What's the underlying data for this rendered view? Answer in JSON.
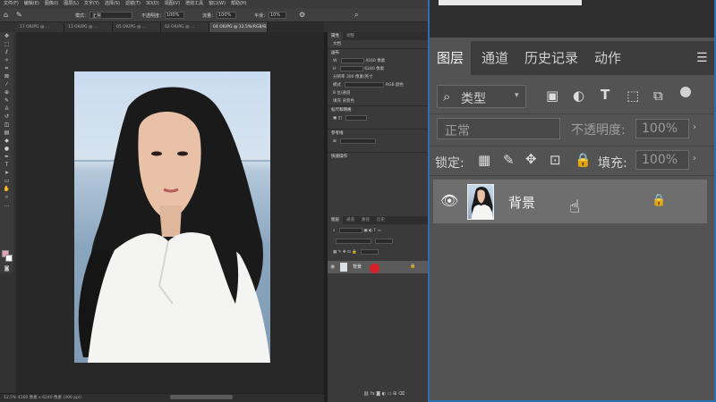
{
  "menu": [
    "文件(F)",
    "编辑(E)",
    "图像(I)",
    "图层(L)",
    "文字(Y)",
    "选择(S)",
    "滤镜(T)",
    "3D(D)",
    "视图(V)",
    "增效工具",
    "窗口(W)",
    "帮助(H)"
  ],
  "options_bar": {
    "mode_label": "模式：",
    "mode_value": "正常",
    "opacity_label": "不透明度：",
    "opacity_value": "100%",
    "flow_label": "流量：",
    "flow_value": "100%",
    "smooth_label": "平滑：",
    "smooth_value": "10%"
  },
  "doc_tabs": [
    "17 OIUPG @ ...",
    "13 OIUPG @ ...",
    "05 OIUPG @ ...",
    "02 OIUPG @ ...",
    "03 OIUPG @ ...",
    "04 OIUPG @ 12.5%(RGB/8)"
  ],
  "status_bar": "12.5%   4160 像素 x 6240 像素 (300 ppi)",
  "properties_panel": {
    "tabs": [
      "属性",
      "调整"
    ],
    "doc_label": "文档",
    "canvas_label": "画布",
    "width": "4160 像素",
    "height": "6240 像素",
    "resolution_label": "分辨率",
    "resolution_value": "300 像素/英寸",
    "mode_label": "模式",
    "mode_value": "RGB 颜色",
    "depth_value": "8 位/通道",
    "fill_label": "填充",
    "fill_value": "背景色",
    "rulers_label": "标尺和网格",
    "guides_label": "参考线",
    "quick_label": "快速操作"
  },
  "mini_layers_panel": {
    "tabs": [
      "图层",
      "通道",
      "路径",
      "历史"
    ],
    "layer_name": "背景"
  },
  "zoom_panel": {
    "tabs": [
      "图层",
      "通道",
      "历史记录",
      "动作"
    ],
    "filter_label": "类型",
    "blend_mode": "正常",
    "opacity_label": "不透明度:",
    "opacity_value": "100%",
    "lock_label": "锁定:",
    "fill_label": "填充:",
    "fill_value": "100%",
    "layer_name": "背景"
  },
  "icons": [
    "search-icon",
    "image-filter-icon",
    "adjustment-filter-icon",
    "type-filter-icon",
    "shape-filter-icon",
    "smart-object-filter-icon",
    "lock-pixels-icon",
    "lock-brush-icon",
    "lock-move-icon",
    "lock-artboard-icon",
    "lock-all-icon",
    "eye-icon",
    "lock-icon",
    "hand-cursor-icon",
    "panel-menu-icon"
  ],
  "colors": {
    "accent_border": "#2a6fb0",
    "panel_bg": "#535353",
    "selected_layer": "#6e6e6e",
    "red_marker": "#d81f26"
  }
}
